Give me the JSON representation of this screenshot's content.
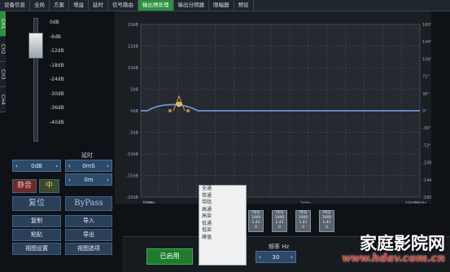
{
  "tabs": [
    "设备信息",
    "全局",
    "方案",
    "增益",
    "延时",
    "信号路由",
    "输出预处理",
    "输出分频器",
    "限幅器",
    "预设"
  ],
  "active_tab": 6,
  "channels": [
    "CH1",
    "CH2",
    "CH3",
    "CH4"
  ],
  "fader": {
    "ticks": [
      "0dB",
      "-6dB",
      "-12dB",
      "-18dB",
      "-24dB",
      "-30dB",
      "-36dB",
      "-40dB"
    ],
    "level_fraction": 0.15
  },
  "gain_spin": {
    "value": "0dB"
  },
  "delay": {
    "label": "延时",
    "value": "0mS",
    "unit_value": "0m"
  },
  "buttons": {
    "mute": "静音",
    "mid": "中",
    "reset": "复位",
    "bypass": "ByPass",
    "copy": "复制",
    "import": "导入",
    "paste": "粘贴",
    "export": "导出",
    "view_settings": "视图设置",
    "view_options": "视图选项"
  },
  "graph": {
    "y_left": [
      "20dB",
      "15dB",
      "10dB",
      "5dB",
      "0dB",
      "-5dB",
      "-10dB",
      "-15dB",
      "-20dB"
    ],
    "y_right": [
      "180°",
      "144°",
      "108°",
      "72°",
      "36°",
      "0°",
      "-36°",
      "-72°",
      "-108°",
      "-144°",
      "-180°"
    ],
    "x_ticks": [
      "20Hz",
      "100Hz",
      "1kHz",
      "10kHz",
      "20kHz"
    ]
  },
  "menu": {
    "items": [
      "全通",
      "带通",
      "带阻",
      "高通",
      "高架",
      "低通",
      "低架",
      "峰值"
    ],
    "selected": "峰值"
  },
  "peq_cards": [
    {
      "type": "PEQ",
      "freq": "1000",
      "q": "1.41",
      "gain": "0"
    },
    {
      "type": "PEQ",
      "freq": "1000",
      "q": "1.41",
      "gain": "0"
    },
    {
      "type": "PEQ",
      "freq": "1000",
      "q": "1.41",
      "gain": "0"
    },
    {
      "type": "PEQ",
      "freq": "1000",
      "q": "1.41",
      "gain": "0"
    }
  ],
  "bottom": {
    "enable": "已启用",
    "freq_label": "频率 Hz",
    "freq_value": "30",
    "type_value": "峰值"
  },
  "watermark": {
    "title": "家庭影院网",
    "url": "www.hdav.com.cn"
  }
}
